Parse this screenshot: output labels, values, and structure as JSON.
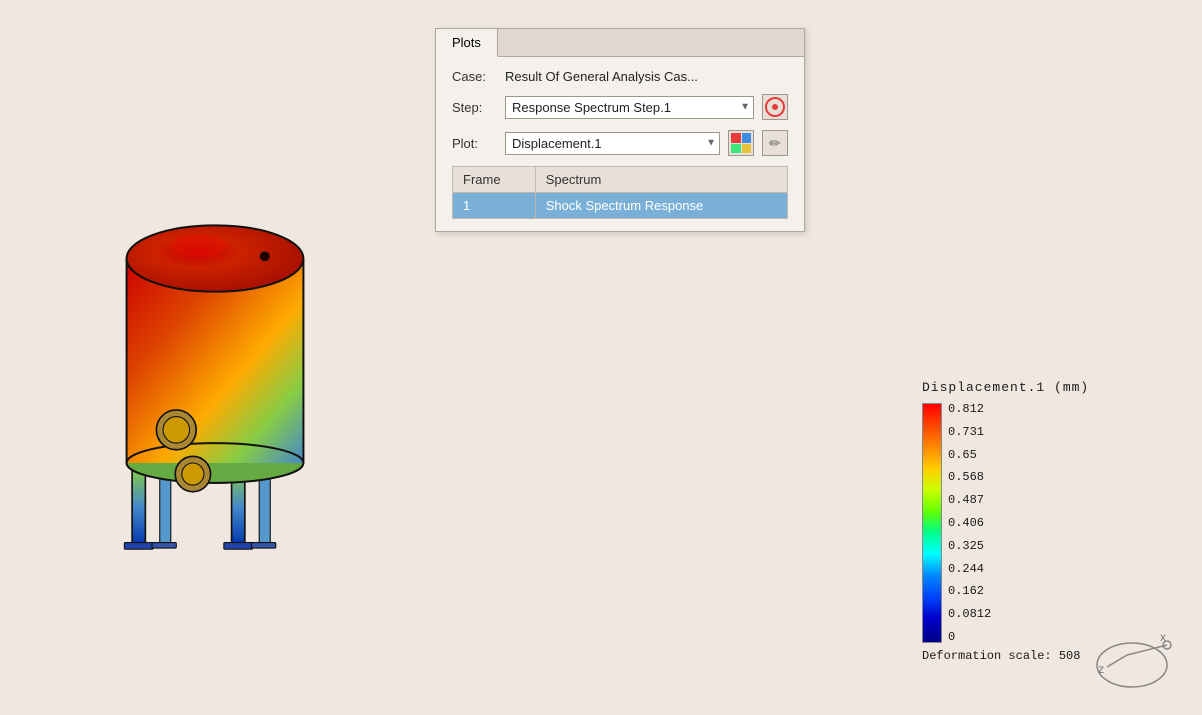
{
  "app": {
    "background_color": "#f0e8e0"
  },
  "panel": {
    "tab_label": "Plots",
    "case_label": "Case:",
    "case_value": "Result Of General Analysis Cas...",
    "step_label": "Step:",
    "plot_label": "Plot:",
    "step_dropdown": {
      "selected": "Response Spectrum Step.1",
      "options": [
        "Response Spectrum Step.1"
      ]
    },
    "plot_dropdown": {
      "selected": "Displacement.1",
      "options": [
        "Displacement.1"
      ]
    },
    "table": {
      "columns": [
        "Frame",
        "Spectrum"
      ],
      "rows": [
        {
          "frame": "1",
          "spectrum": "Shock Spectrum Response",
          "selected": true
        }
      ]
    }
  },
  "legend": {
    "title": "Displacement.1 (mm)",
    "values": [
      "0.812",
      "0.731",
      "0.65",
      "0.568",
      "0.487",
      "0.406",
      "0.325",
      "0.244",
      "0.162",
      "0.0812",
      "0"
    ],
    "deformation_label": "Deformation scale: 508"
  },
  "icons": {
    "nav_icon": "circle",
    "plot_icon": "grid",
    "pencil_icon": "✏"
  }
}
